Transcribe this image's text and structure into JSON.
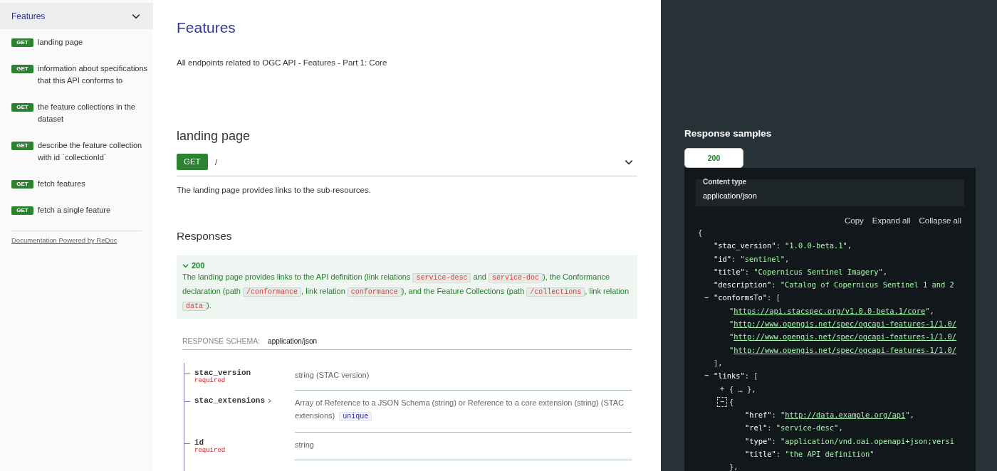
{
  "sidebar": {
    "group": {
      "label": "Features",
      "expanded": true
    },
    "items": [
      {
        "method": "GET",
        "label": "landing page"
      },
      {
        "method": "GET",
        "label": "information about specifications that this API conforms to"
      },
      {
        "method": "GET",
        "label": "the feature collections in the dataset"
      },
      {
        "method": "GET",
        "label": "describe the feature collection with id `collectionId`"
      },
      {
        "method": "GET",
        "label": "fetch features"
      },
      {
        "method": "GET",
        "label": "fetch a single feature"
      }
    ],
    "footer_link": "Documentation Powered by ReDoc"
  },
  "main": {
    "title": "Features",
    "description": "All endpoints related to OGC API - Features - Part 1: Core",
    "operation": {
      "title": "landing page",
      "method": "GET",
      "path": "/",
      "summary": "The landing page provides links to the sub-resources.",
      "responses_title": "Responses",
      "responses": [
        {
          "code": "200",
          "expanded": true,
          "description": [
            {
              "kind": "text",
              "text": "The landing page provides links to the API definition (link relations "
            },
            {
              "kind": "code",
              "text": "service-desc"
            },
            {
              "kind": "text",
              "text": " and "
            },
            {
              "kind": "code",
              "text": "service-doc"
            },
            {
              "kind": "text",
              "text": "), the Conformance declaration (path "
            },
            {
              "kind": "code",
              "text": "/conformance"
            },
            {
              "kind": "text",
              "text": ", link relation "
            },
            {
              "kind": "code",
              "text": "conformance"
            },
            {
              "kind": "text",
              "text": "), and the Feature Collections (path "
            },
            {
              "kind": "code",
              "text": "/collections"
            },
            {
              "kind": "text",
              "text": ", link relation "
            },
            {
              "kind": "code",
              "text": "data"
            },
            {
              "kind": "text",
              "text": ")."
            }
          ]
        }
      ],
      "schema": {
        "label": "RESPONSE SCHEMA:",
        "content_type": "application/json",
        "properties": [
          {
            "name": "stac_version",
            "badge": "required",
            "expandable": false,
            "description": "string (STAC version)"
          },
          {
            "name": "stac_extensions",
            "expandable": true,
            "description": "Array of Reference to a JSON Schema (string) or Reference to a core extension (string) (STAC extensions)",
            "tags": [
              "unique"
            ]
          },
          {
            "name": "id",
            "badge": "required",
            "expandable": false,
            "description": "string"
          }
        ]
      }
    }
  },
  "samples": {
    "title": "Response samples",
    "tabs": [
      {
        "label": "200",
        "selected": true
      }
    ],
    "content_type": {
      "label": "Content type",
      "value": "application/json"
    },
    "actions": [
      "Copy",
      "Expand all",
      "Collapse all"
    ],
    "code": [
      {
        "parts": [
          {
            "kind": "punct",
            "text": "{"
          }
        ],
        "children": [
          {
            "parts": [
              {
                "kind": "key",
                "text": "\"stac_version\""
              },
              {
                "kind": "punct",
                "text": ": "
              },
              {
                "kind": "string",
                "text": "\"1.0.0-beta.1\""
              },
              {
                "kind": "punct",
                "text": ","
              }
            ]
          },
          {
            "parts": [
              {
                "kind": "key",
                "text": "\"id\""
              },
              {
                "kind": "punct",
                "text": ": "
              },
              {
                "kind": "string",
                "text": "\"sentinel\""
              },
              {
                "kind": "punct",
                "text": ","
              }
            ]
          },
          {
            "parts": [
              {
                "kind": "key",
                "text": "\"title\""
              },
              {
                "kind": "punct",
                "text": ": "
              },
              {
                "kind": "string",
                "text": "\"Copernicus Sentinel Imagery\""
              },
              {
                "kind": "punct",
                "text": ","
              }
            ]
          },
          {
            "parts": [
              {
                "kind": "key",
                "text": "\"description\""
              },
              {
                "kind": "punct",
                "text": ": "
              },
              {
                "kind": "string",
                "text": "\"Catalog of Copernicus Sentinel 1 and 2"
              }
            ]
          },
          {
            "toggle": "−",
            "expanded": true,
            "focused": false,
            "parts": [
              {
                "kind": "key",
                "text": "\"conformsTo\""
              },
              {
                "kind": "punct",
                "text": ": ["
              }
            ],
            "children": [
              {
                "parts": [
                  {
                    "kind": "string",
                    "text": "\""
                  },
                  {
                    "kind": "link",
                    "text": "https://api.stacspec.org/v1.0.0-beta.1/core"
                  },
                  {
                    "kind": "string",
                    "text": "\""
                  },
                  {
                    "kind": "punct",
                    "text": ","
                  }
                ]
              },
              {
                "parts": [
                  {
                    "kind": "string",
                    "text": "\""
                  },
                  {
                    "kind": "link",
                    "text": "http://www.opengis.net/spec/ogcapi-features-1/1.0/"
                  }
                ]
              },
              {
                "parts": [
                  {
                    "kind": "string",
                    "text": "\""
                  },
                  {
                    "kind": "link",
                    "text": "http://www.opengis.net/spec/ogcapi-features-1/1.0/"
                  }
                ]
              },
              {
                "parts": [
                  {
                    "kind": "string",
                    "text": "\""
                  },
                  {
                    "kind": "link",
                    "text": "http://www.opengis.net/spec/ogcapi-features-1/1.0/"
                  }
                ]
              }
            ],
            "closing": [
              {
                "kind": "punct",
                "text": "],"
              }
            ]
          },
          {
            "toggle": "−",
            "expanded": true,
            "focused": false,
            "parts": [
              {
                "kind": "key",
                "text": "\"links\""
              },
              {
                "kind": "punct",
                "text": ": ["
              }
            ],
            "children": [
              {
                "toggle": "+",
                "expanded": false,
                "focused": false,
                "parts": [
                  {
                    "kind": "punct",
                    "text": "{ … },"
                  }
                ]
              },
              {
                "toggle": "−",
                "expanded": true,
                "focused": true,
                "parts": [
                  {
                    "kind": "punct",
                    "text": "{"
                  }
                ],
                "children": [
                  {
                    "parts": [
                      {
                        "kind": "key",
                        "text": "\"href\""
                      },
                      {
                        "kind": "punct",
                        "text": ": "
                      },
                      {
                        "kind": "string",
                        "text": "\""
                      },
                      {
                        "kind": "link",
                        "text": "http://data.example.org/api"
                      },
                      {
                        "kind": "string",
                        "text": "\""
                      },
                      {
                        "kind": "punct",
                        "text": ","
                      }
                    ]
                  },
                  {
                    "parts": [
                      {
                        "kind": "key",
                        "text": "\"rel\""
                      },
                      {
                        "kind": "punct",
                        "text": ": "
                      },
                      {
                        "kind": "string",
                        "text": "\"service-desc\""
                      },
                      {
                        "kind": "punct",
                        "text": ","
                      }
                    ]
                  },
                  {
                    "parts": [
                      {
                        "kind": "key",
                        "text": "\"type\""
                      },
                      {
                        "kind": "punct",
                        "text": ": "
                      },
                      {
                        "kind": "string",
                        "text": "\"application/vnd.oai.openapi+json;versi"
                      }
                    ]
                  },
                  {
                    "parts": [
                      {
                        "kind": "key",
                        "text": "\"title\""
                      },
                      {
                        "kind": "punct",
                        "text": ": "
                      },
                      {
                        "kind": "string",
                        "text": "\"the API definition\""
                      }
                    ]
                  }
                ],
                "closing": [
                  {
                    "kind": "punct",
                    "text": "},"
                  }
                ]
              }
            ]
          }
        ]
      }
    ]
  }
}
